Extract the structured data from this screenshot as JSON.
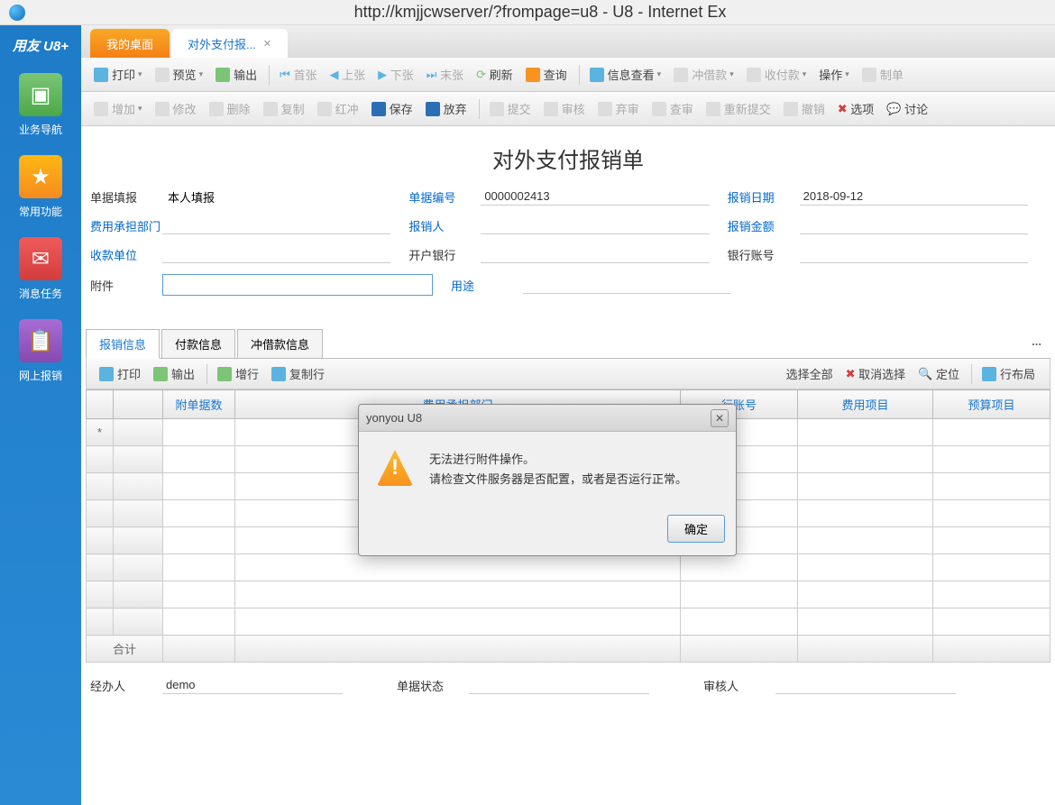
{
  "browser": {
    "url_title": "http://kmjjcwserver/?frompage=u8 - U8 - Internet Ex"
  },
  "sidebar": {
    "logo": "用友 U8+",
    "items": [
      {
        "label": "业务导航"
      },
      {
        "label": "常用功能"
      },
      {
        "label": "消息任务"
      },
      {
        "label": "网上报销"
      }
    ]
  },
  "tabs": [
    {
      "label": "我的桌面",
      "active_variant": "orange"
    },
    {
      "label": "对外支付报...",
      "active_variant": "blue",
      "closable": true
    }
  ],
  "toolbar1": {
    "print": "打印",
    "preview": "预览",
    "export": "输出",
    "first": "首张",
    "prev": "上张",
    "next": "下张",
    "last": "末张",
    "refresh": "刷新",
    "query": "查询",
    "info_query": "信息查看",
    "offset": "冲借款",
    "receive_pay": "收付款",
    "action": "操作",
    "make": "制单"
  },
  "toolbar2": {
    "add": "增加",
    "modify": "修改",
    "delete": "删除",
    "copy": "复制",
    "red": "红冲",
    "save": "保存",
    "abandon": "放弃",
    "submit": "提交",
    "audit": "审核",
    "unaudit": "弃审",
    "review": "查审",
    "resubmit": "重新提交",
    "revoke": "撤销",
    "option": "选项",
    "discuss": "讨论"
  },
  "form": {
    "title": "对外支付报销单",
    "fields": {
      "bill_fill": {
        "label": "单据填报",
        "value": "本人填报"
      },
      "bill_no": {
        "label": "单据编号",
        "value": "0000002413"
      },
      "reimburse_date": {
        "label": "报销日期",
        "value": "2018-09-12"
      },
      "expense_dept": {
        "label": "费用承担部门",
        "value": ""
      },
      "reimburser": {
        "label": "报销人",
        "value": ""
      },
      "amount": {
        "label": "报销金额",
        "value": ""
      },
      "payee": {
        "label": "收款单位",
        "value": ""
      },
      "bank": {
        "label": "开户银行",
        "value": ""
      },
      "account": {
        "label": "银行账号",
        "value": ""
      },
      "attachment": {
        "label": "附件",
        "value": ""
      },
      "purpose": {
        "label": "用途",
        "value": ""
      }
    }
  },
  "sub_tabs": [
    {
      "label": "报销信息",
      "active": true
    },
    {
      "label": "付款信息"
    },
    {
      "label": "冲借款信息"
    }
  ],
  "sub_toolbar": {
    "print": "打印",
    "export": "输出",
    "add_row": "增行",
    "copy_row": "复制行",
    "select_all": "选择全部",
    "cancel_select": "取消选择",
    "locate": "定位",
    "row_layout": "行布局"
  },
  "table": {
    "columns": [
      "",
      "",
      "附单据数",
      "费用承担部门",
      "行账号",
      "费用项目",
      "预算项目"
    ],
    "indicator_star": "*",
    "sum_label": "合计"
  },
  "footer": {
    "operator": {
      "label": "经办人",
      "value": "demo"
    },
    "bill_status": {
      "label": "单据状态",
      "value": ""
    },
    "auditor": {
      "label": "审核人",
      "value": ""
    }
  },
  "dialog": {
    "title": "yonyou U8",
    "message_line1": "无法进行附件操作。",
    "message_line2": "请检查文件服务器是否配置，或者是否运行正常。",
    "ok": "确定"
  }
}
